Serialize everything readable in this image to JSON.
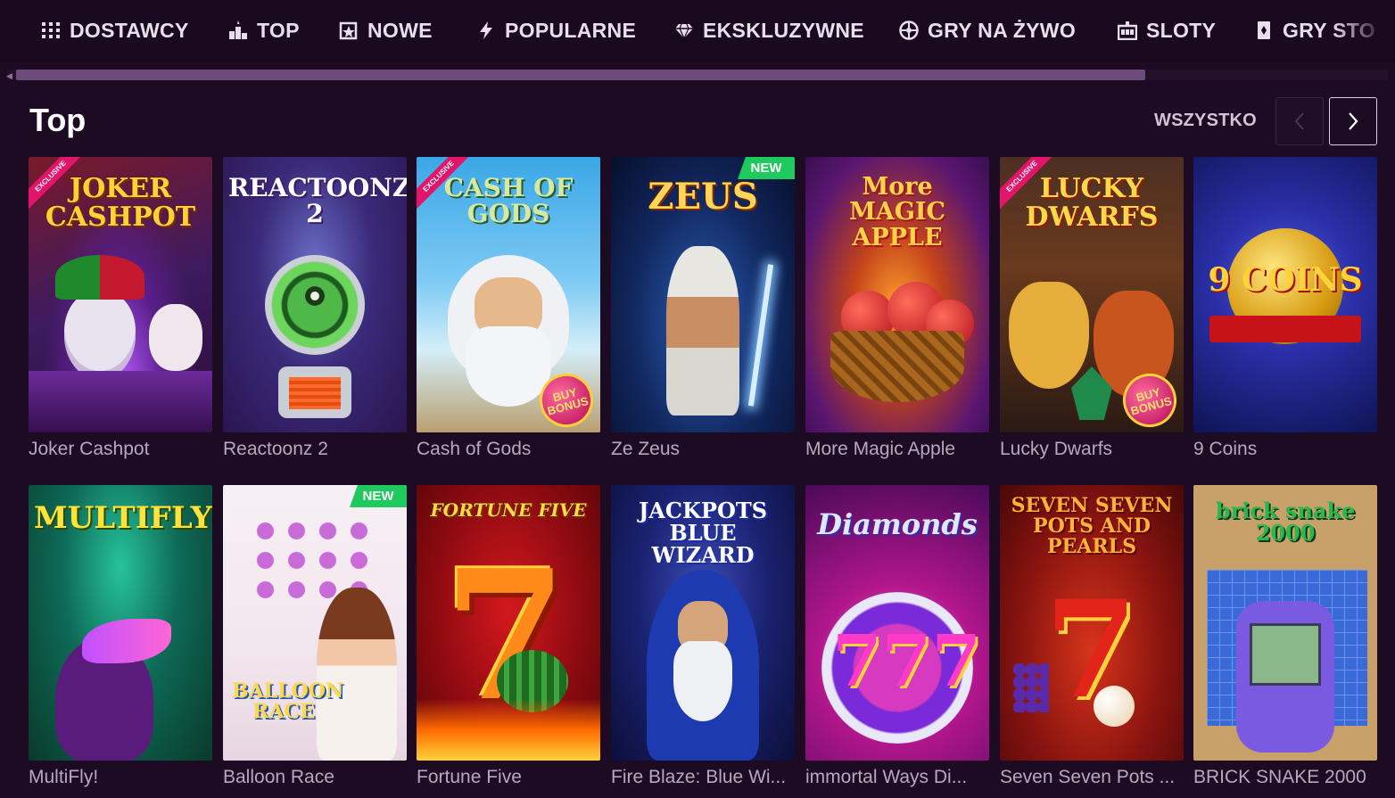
{
  "nav": {
    "items": [
      {
        "label": "DOSTAWCY",
        "icon": "grid-icon"
      },
      {
        "label": "TOP",
        "icon": "podium-icon"
      },
      {
        "label": "NOWE",
        "icon": "new-star-icon"
      },
      {
        "label": "POPULARNE",
        "icon": "lightning-icon"
      },
      {
        "label": "EKSKLUZYWNE",
        "icon": "diamond-icon"
      },
      {
        "label": "GRY NA ŻYWO",
        "icon": "roulette-icon"
      },
      {
        "label": "SLOTY",
        "icon": "slot-machine-icon"
      },
      {
        "label": "GRY STO",
        "icon": "cards-icon"
      }
    ]
  },
  "section": {
    "title": "Top",
    "see_all": "WSZYSTKO"
  },
  "games": [
    {
      "name": "Joker Cashpot",
      "art_title": "JOKER CASHPOT",
      "badge": "EXCLUSIVE",
      "bonus": ""
    },
    {
      "name": "Reactoonz 2",
      "art_title": "REACTOONZ 2",
      "badge": "",
      "bonus": ""
    },
    {
      "name": "Cash of Gods",
      "art_title": "CASH OF GODS",
      "badge": "EXCLUSIVE",
      "bonus": "BUY BONUS"
    },
    {
      "name": "Ze Zeus",
      "art_title": "ZEUS",
      "badge": "NEW",
      "bonus": ""
    },
    {
      "name": "More Magic Apple",
      "art_title": "More MAGIC APPLE",
      "badge": "",
      "bonus": ""
    },
    {
      "name": "Lucky Dwarfs",
      "art_title": "LUCKY DWARFS",
      "badge": "EXCLUSIVE",
      "bonus": "BUY BONUS"
    },
    {
      "name": "9 Coins",
      "art_title": "9 COINS",
      "badge": "",
      "bonus": ""
    },
    {
      "name": "MultiFly!",
      "art_title": "MULTIFLY!",
      "badge": "",
      "bonus": ""
    },
    {
      "name": "Balloon Race",
      "art_title": "BALLOON RACE",
      "badge": "NEW",
      "bonus": ""
    },
    {
      "name": "Fortune Five",
      "art_title": "FORTUNE FIVE",
      "badge": "",
      "bonus": ""
    },
    {
      "name": "Fire Blaze: Blue Wi...",
      "art_title": "JACKPOTS BLUE WIZARD",
      "badge": "",
      "bonus": ""
    },
    {
      "name": "immortal Ways Di...",
      "art_title": "Diamonds",
      "badge": "",
      "bonus": ""
    },
    {
      "name": "Seven Seven Pots ...",
      "art_title": "SEVEN SEVEN POTS AND PEARLS",
      "badge": "",
      "bonus": ""
    },
    {
      "name": "BRICK SNAKE 2000",
      "art_title": "brick snake 2000",
      "badge": "",
      "bonus": ""
    }
  ]
}
